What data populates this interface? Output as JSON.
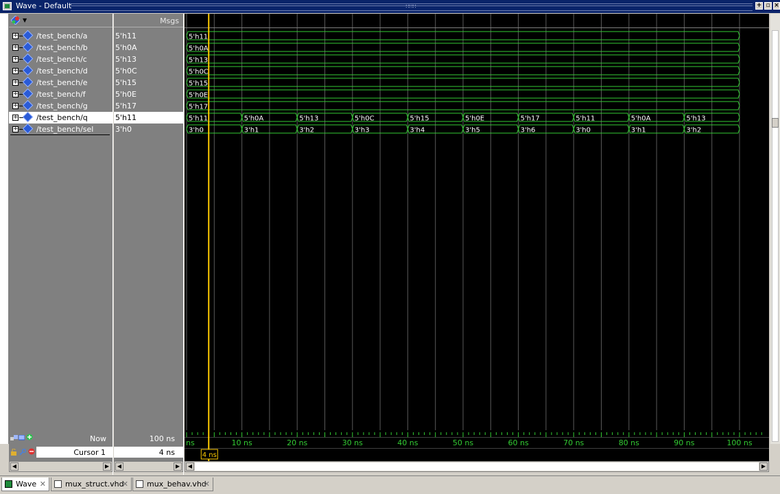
{
  "window": {
    "title": "Wave - Default"
  },
  "header": {
    "msgs_label": "Msgs"
  },
  "signals": [
    {
      "name": "/test_bench/a",
      "value": "5'h11",
      "selected": false
    },
    {
      "name": "/test_bench/b",
      "value": "5'h0A",
      "selected": false
    },
    {
      "name": "/test_bench/c",
      "value": "5'h13",
      "selected": false
    },
    {
      "name": "/test_bench/d",
      "value": "5'h0C",
      "selected": false
    },
    {
      "name": "/test_bench/e",
      "value": "5'h15",
      "selected": false
    },
    {
      "name": "/test_bench/f",
      "value": "5'h0E",
      "selected": false
    },
    {
      "name": "/test_bench/g",
      "value": "5'h17",
      "selected": false
    },
    {
      "name": "/test_bench/q",
      "value": "5'h11",
      "selected": true
    },
    {
      "name": "/test_bench/sel",
      "value": "3'h0",
      "selected": false
    }
  ],
  "wave_labels": {
    "a": [
      "5'h11"
    ],
    "b": [
      "5'h0A"
    ],
    "c": [
      "5'h13"
    ],
    "d": [
      "5'h0C"
    ],
    "e": [
      "5'h15"
    ],
    "f": [
      "5'h0E"
    ],
    "g": [
      "5'h17"
    ],
    "q": [
      "5'h11",
      "5'h0A",
      "5'h13",
      "5'h0C",
      "5'h15",
      "5'h0E",
      "5'h17",
      "5'h11",
      "5'h0A",
      "5'h13"
    ],
    "sel": [
      "3'h0",
      "3'h1",
      "3'h2",
      "3'h3",
      "3'h4",
      "3'h5",
      "3'h6",
      "3'h0",
      "3'h1",
      "3'h2"
    ]
  },
  "wave_colors": {
    "signal": "#33cc33",
    "cursor": "#ffcc00",
    "grid": "#5a5a5a",
    "text": "#ffffff",
    "ticks": "#33cc33"
  },
  "time_axis": {
    "start_label": "ns",
    "ticks": [
      "10 ns",
      "20 ns",
      "30 ns",
      "40 ns",
      "50 ns",
      "60 ns",
      "70 ns",
      "80 ns",
      "90 ns",
      "100 ns"
    ]
  },
  "footer": {
    "now_label": "Now",
    "now_value": "100 ns",
    "cursor_label": "Cursor 1",
    "cursor_value": "4 ns",
    "cursor_marker": "4 ns"
  },
  "tabs": [
    {
      "label": "Wave",
      "active": true
    },
    {
      "label": "mux_struct.vhd",
      "active": false
    },
    {
      "label": "mux_behav.vhd",
      "active": false
    }
  ]
}
